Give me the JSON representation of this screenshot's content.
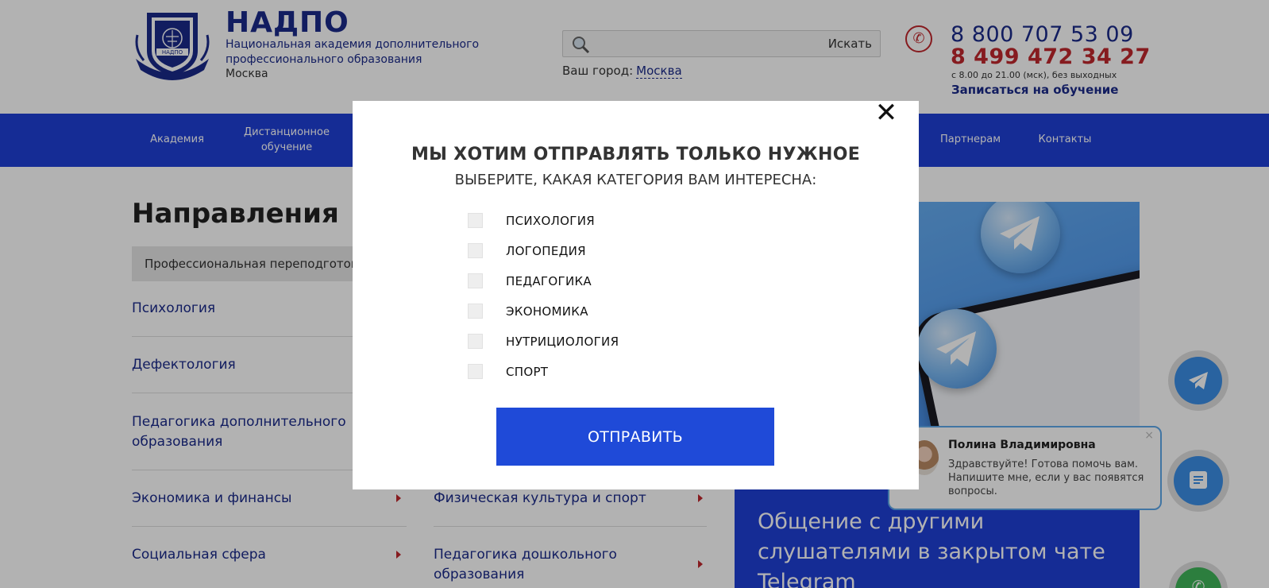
{
  "header": {
    "brand_title": "НАДПО",
    "brand_subtitle": "Национальная академия дополнительного профессионального образования",
    "brand_city": "Москва",
    "logo_text": "НАДПО",
    "search": {
      "placeholder": "",
      "button_label": "Искать",
      "icon": "search-icon"
    },
    "city_label": "Ваш город:",
    "city_value": "Москва",
    "phone_primary": "8 800 707 53 09",
    "phone_secondary": "8 499 472 34 27",
    "phone_hours": "с 8.00 до 21.00 (мск), без выходных",
    "enroll_link": "Записаться на обучение"
  },
  "nav": {
    "items": [
      {
        "label": "Академия"
      },
      {
        "label": "Дистанционное обучение"
      },
      {
        "label": "Партнерам"
      },
      {
        "label": "Контакты"
      }
    ]
  },
  "main": {
    "section_title": "Направления",
    "active_tab": "Профессиональная переподготовка",
    "left_column": [
      "Психология",
      "Дефектология",
      "Педагогика дополнительного образования",
      "Экономика и финансы",
      "Социальная сфера"
    ],
    "right_column": [
      "Физическая культура и спорт",
      "Педагогика дошкольного образования"
    ]
  },
  "banner": {
    "text": "Общение с другими слушателями в закрытом чате Telegram"
  },
  "chat": {
    "agent_name": "Полина Владимировна",
    "message": "Здравствуйте! Готова помочь вам. Напишите мне, если у вас появятся вопросы.",
    "close": "×"
  },
  "modal": {
    "close": "✕",
    "title": "МЫ ХОТИМ ОТПРАВЛЯТЬ ТОЛЬКО НУЖНОЕ",
    "subtitle": "ВЫБЕРИТЕ, КАКАЯ КАТЕГОРИЯ ВАМ ИНТЕРЕСНА:",
    "options": [
      {
        "label": "ПСИХОЛОГИЯ",
        "checked": false
      },
      {
        "label": "ЛОГОПЕДИЯ",
        "checked": false
      },
      {
        "label": "ПЕДАГОГИКА",
        "checked": false
      },
      {
        "label": "ЭКОНОМИКА",
        "checked": false
      },
      {
        "label": "НУТРИЦИОЛОГИЯ",
        "checked": false
      },
      {
        "label": "СПОРТ",
        "checked": false
      }
    ],
    "submit_label": "ОТПРАВИТЬ"
  },
  "colors": {
    "brand_blue": "#1b2a8a",
    "nav_blue": "#1f3fd6",
    "accent_red": "#c0282d",
    "submit_blue": "#1f4ad8"
  }
}
